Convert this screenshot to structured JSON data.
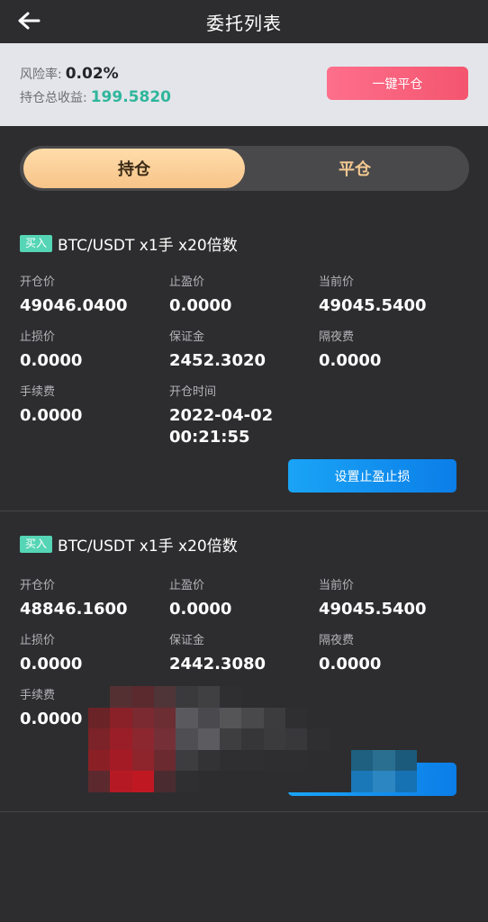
{
  "header": {
    "title": "委托列表",
    "back_icon": "arrow-left-icon"
  },
  "risk": {
    "rate_label": "风险率:",
    "rate_value": "0.02%",
    "profit_label": "持仓总收益:",
    "profit_value": "199.5820",
    "close_all_label": "一键平仓",
    "colors": {
      "profit": "#2fb69c",
      "close_all": "#f4556f"
    }
  },
  "tabs": [
    {
      "label": "持仓",
      "active": true
    },
    {
      "label": "平仓",
      "active": false
    }
  ],
  "positions": [
    {
      "badge": "买入",
      "pair": "BTC/USDT x1手 x20倍数",
      "fields": [
        {
          "label": "开仓价",
          "value": "49046.0400"
        },
        {
          "label": "止盈价",
          "value": "0.0000"
        },
        {
          "label": "当前价",
          "value": "49045.5400"
        },
        {
          "label": "止损价",
          "value": "0.0000"
        },
        {
          "label": "保证金",
          "value": "2452.3020"
        },
        {
          "label": "隔夜费",
          "value": "0.0000"
        },
        {
          "label": "手续费",
          "value": "0.0000"
        },
        {
          "label": "开仓时间",
          "value_date": "2022-04-02",
          "value_time": "00:21:55"
        }
      ],
      "button_label": "设置止盈止损"
    },
    {
      "badge": "买入",
      "pair": "BTC/USDT x1手 x20倍数",
      "fields": [
        {
          "label": "开仓价",
          "value": "48846.1600"
        },
        {
          "label": "止盈价",
          "value": "0.0000"
        },
        {
          "label": "当前价",
          "value": "49045.5400"
        },
        {
          "label": "止损价",
          "value": "0.0000"
        },
        {
          "label": "保证金",
          "value": "2442.3080"
        },
        {
          "label": "隔夜费",
          "value": "0.0000"
        },
        {
          "label": "手续费",
          "value": "0.0000"
        }
      ]
    }
  ],
  "colors": {
    "background": "#2d2d2f",
    "buy_badge": "#55d5b5",
    "button_blue": "#0b7ee8",
    "tab_active": "#f7c489"
  }
}
